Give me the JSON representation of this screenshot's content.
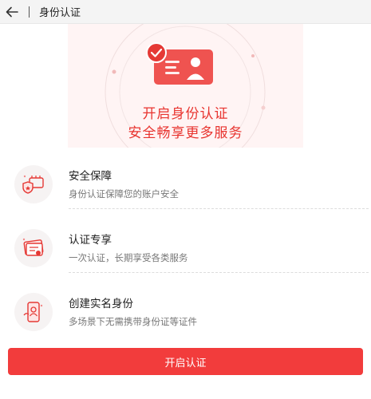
{
  "header": {
    "title": "身份认证"
  },
  "hero": {
    "line1": "开启身份认证",
    "line2": "安全畅享更多服务"
  },
  "features": [
    {
      "title": "安全保障",
      "desc": "身份认证保障您的账户安全",
      "icon": "shield-card-icon"
    },
    {
      "title": "认证专享",
      "desc": "一次认证，长期享受各类服务",
      "icon": "certificate-icon"
    },
    {
      "title": "创建实名身份",
      "desc": "多场景下无需携带身份证等证件",
      "icon": "phone-id-icon"
    }
  ],
  "cta": {
    "label": "开启认证"
  },
  "colors": {
    "accent": "#f23c3c",
    "hero_text": "#e8342f",
    "hero_bg": "#fff4f4"
  }
}
